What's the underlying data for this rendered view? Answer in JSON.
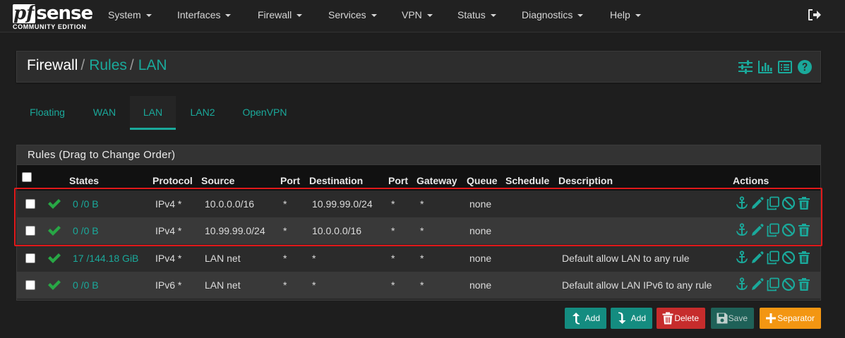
{
  "brand": {
    "logo_pf": "pf",
    "logo_sense": "sense",
    "edition": "COMMUNITY EDITION"
  },
  "nav": {
    "items": [
      {
        "label": "System"
      },
      {
        "label": "Interfaces"
      },
      {
        "label": "Firewall"
      },
      {
        "label": "Services"
      },
      {
        "label": "VPN"
      },
      {
        "label": "Status"
      },
      {
        "label": "Diagnostics"
      },
      {
        "label": "Help"
      }
    ],
    "logout_icon": "sign-out-icon"
  },
  "breadcrumb": {
    "first": "Firewall",
    "sep": "/",
    "second": "Rules",
    "third": "LAN"
  },
  "header_icons": [
    "sliders-icon",
    "bar-chart-icon",
    "list-icon",
    "help-icon"
  ],
  "tabs": [
    {
      "label": "Floating"
    },
    {
      "label": "WAN"
    },
    {
      "label": "LAN",
      "active": true
    },
    {
      "label": "LAN2"
    },
    {
      "label": "OpenVPN"
    }
  ],
  "panel": {
    "title": "Rules (Drag to Change Order)"
  },
  "columns": {
    "states": "States",
    "protocol": "Protocol",
    "source": "Source",
    "port": "Port",
    "destination": "Destination",
    "port2": "Port",
    "gateway": "Gateway",
    "queue": "Queue",
    "schedule": "Schedule",
    "description": "Description",
    "actions": "Actions"
  },
  "rules": [
    {
      "states": "0 /0 B",
      "protocol": "IPv4 *",
      "source": "10.0.0.0/16",
      "port": "*",
      "destination": "10.99.99.0/24",
      "port2": "*",
      "gateway": "*",
      "queue": "none",
      "schedule": "",
      "description": ""
    },
    {
      "states": "0 /0 B",
      "protocol": "IPv4 *",
      "source": "10.99.99.0/24",
      "port": "*",
      "destination": "10.0.0.0/16",
      "port2": "*",
      "gateway": "*",
      "queue": "none",
      "schedule": "",
      "description": ""
    },
    {
      "states": "17 /144.18 GiB",
      "protocol": "IPv4 *",
      "source": "LAN net",
      "port": "*",
      "destination": "*",
      "port2": "*",
      "gateway": "*",
      "queue": "none",
      "schedule": "",
      "description": "Default allow LAN to any rule"
    },
    {
      "states": "0 /0 B",
      "protocol": "IPv6 *",
      "source": "LAN net",
      "port": "*",
      "destination": "*",
      "port2": "*",
      "gateway": "*",
      "queue": "none",
      "schedule": "",
      "description": "Default allow LAN IPv6 to any rule"
    }
  ],
  "row_action_icons": [
    "anchor-icon",
    "pencil-icon",
    "copy-icon",
    "ban-icon",
    "trash-icon"
  ],
  "buttons": {
    "add_top": "Add",
    "add_bottom": "Add",
    "delete": "Delete",
    "save": "Save",
    "separator": "Separator"
  },
  "colors": {
    "accent": "#1aa99b",
    "pass": "#28a745",
    "delete": "#c62c2c",
    "separator": "#f39612",
    "highlight": "#e0191a"
  }
}
